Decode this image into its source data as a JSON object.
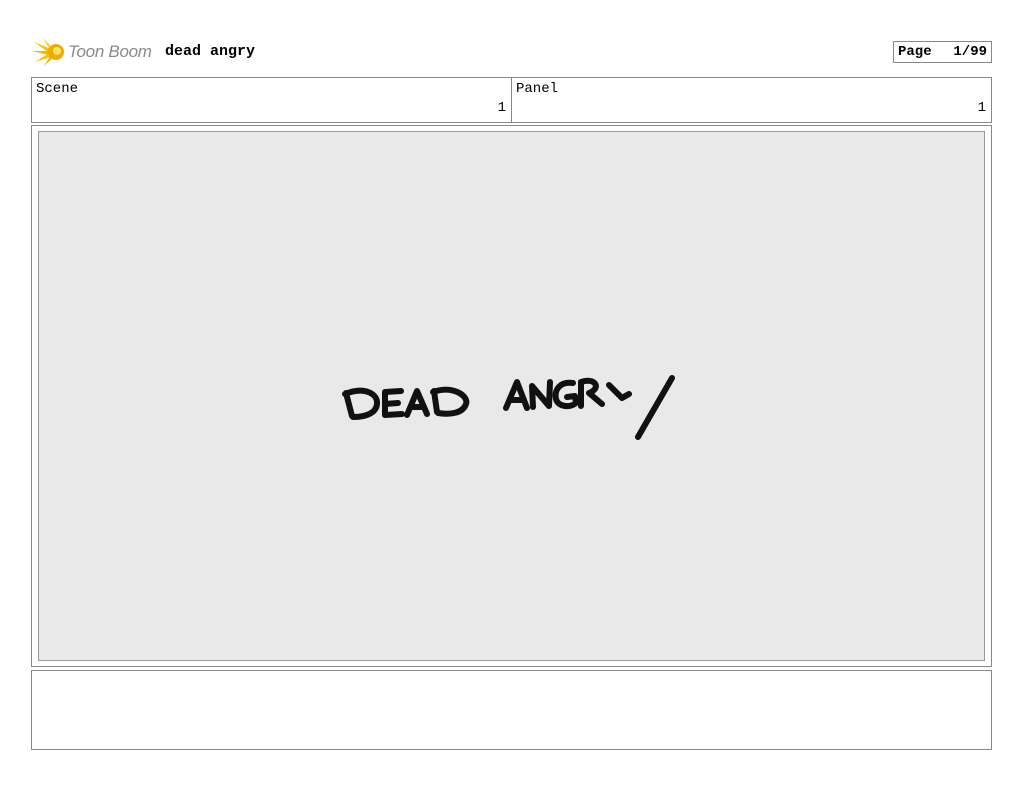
{
  "header": {
    "logo_text": "Toon Boom",
    "logo_icon": "toon-boom-starburst-icon",
    "project_title": "dead angry",
    "page_label": "Page",
    "page_number": "1/99"
  },
  "info": {
    "scene_label": "Scene",
    "scene_value": "1",
    "panel_label": "Panel",
    "panel_value": "1"
  },
  "panel": {
    "drawing_text": "DEAD ANGRY",
    "background_color": "#e9e9e9"
  },
  "notes": {
    "text": ""
  }
}
